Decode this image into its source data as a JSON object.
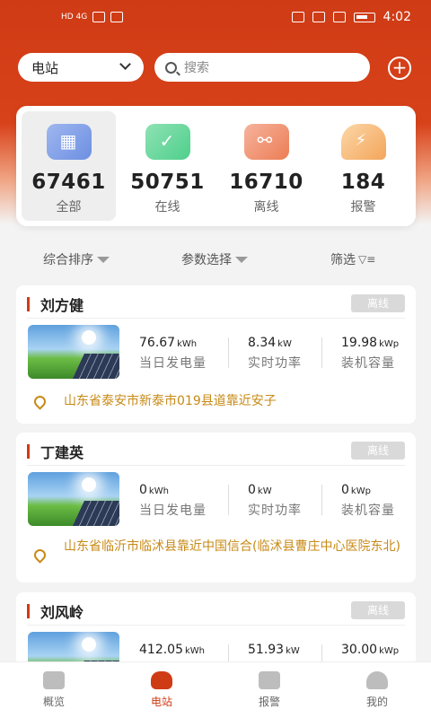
{
  "status_bar": {
    "time": "4:02",
    "left_indicators": "HD 4G"
  },
  "header": {
    "station_select": "电站",
    "search_placeholder": "搜索"
  },
  "stats": [
    {
      "value": "67461",
      "label": "全部"
    },
    {
      "value": "50751",
      "label": "在线"
    },
    {
      "value": "16710",
      "label": "离线"
    },
    {
      "value": "184",
      "label": "报警"
    }
  ],
  "filters": {
    "sort": "综合排序",
    "params": "参数选择",
    "filter": "筛选"
  },
  "stations": [
    {
      "name": "刘方健",
      "status": "离线",
      "daily_value": "76.67",
      "daily_unit": "kWh",
      "daily_label": "当日发电量",
      "power_value": "8.34",
      "power_unit": "kW",
      "power_label": "实时功率",
      "capacity_value": "19.98",
      "capacity_unit": "kWp",
      "capacity_label": "装机容量",
      "address": "山东省泰安市新泰市019县道靠近安子"
    },
    {
      "name": "丁建英",
      "status": "离线",
      "daily_value": "0",
      "daily_unit": "kWh",
      "daily_label": "当日发电量",
      "power_value": "0",
      "power_unit": "kW",
      "power_label": "实时功率",
      "capacity_value": "0",
      "capacity_unit": "kWp",
      "capacity_label": "装机容量",
      "address": "山东省临沂市临沭县靠近中国信合(临沭县曹庄中心医院东北)"
    },
    {
      "name": "刘风岭",
      "status": "离线",
      "daily_value": "412.05",
      "daily_unit": "kWh",
      "power_value": "51.93",
      "power_unit": "kW",
      "capacity_value": "30.00",
      "capacity_unit": "kWp"
    }
  ],
  "tabs": [
    {
      "label": "概览",
      "icon": "chart-icon"
    },
    {
      "label": "电站",
      "icon": "station-icon"
    },
    {
      "label": "报警",
      "icon": "alarm-icon"
    },
    {
      "label": "我的",
      "icon": "user-icon"
    }
  ],
  "colors": {
    "brand": "#cf3b15",
    "address": "#c78a17",
    "badge": "#d9d9d9"
  }
}
